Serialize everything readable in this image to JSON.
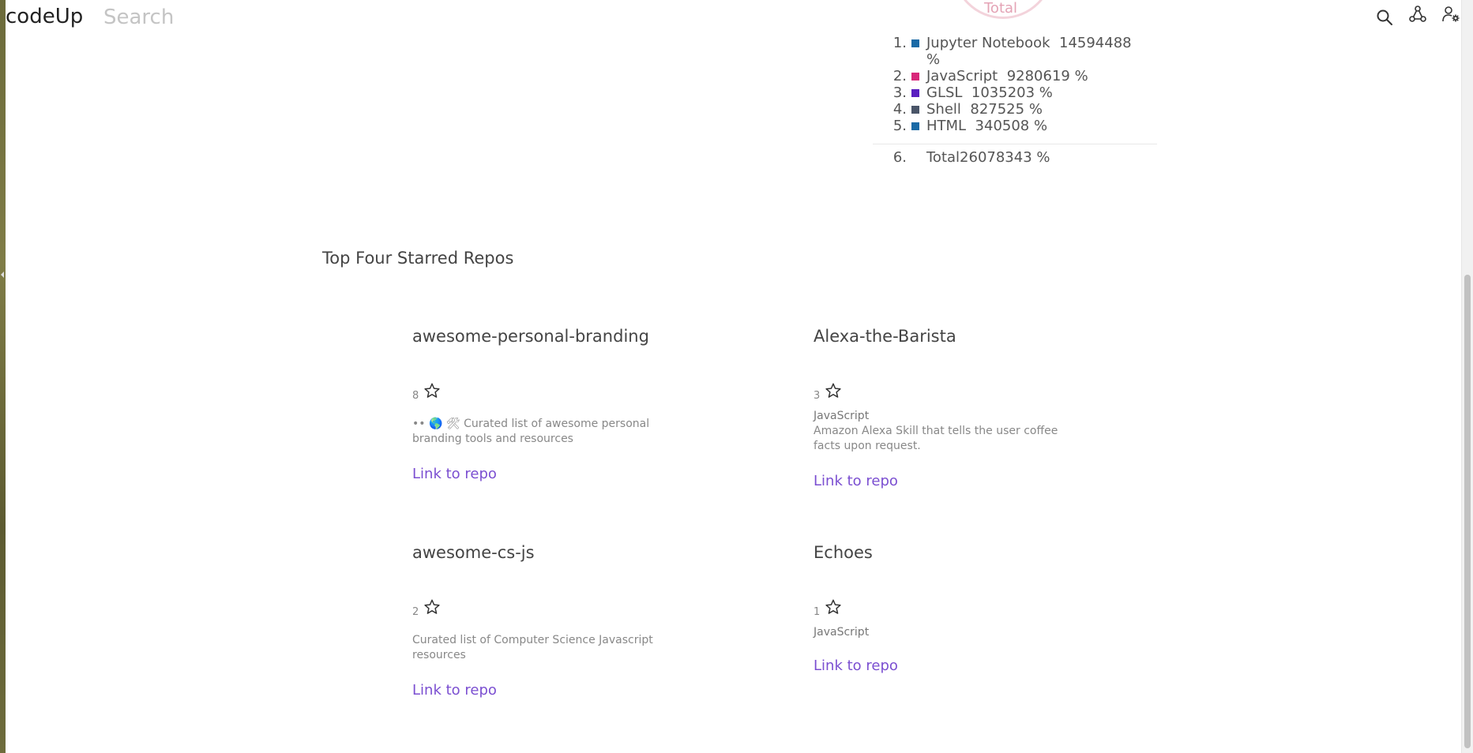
{
  "header": {
    "logo": "codeUp",
    "search_placeholder": "Search",
    "icons": [
      "search-icon",
      "network-icon",
      "user-settings-icon"
    ]
  },
  "languages_chart": {
    "center_label": "Total",
    "items": [
      {
        "num": "1.",
        "name": "Jupyter Notebook",
        "value": "14594488",
        "unit": "%",
        "color": "#1a6aa6"
      },
      {
        "num": "2.",
        "name": "JavaScript",
        "value": "9280619",
        "unit": "%",
        "color": "#d8277a"
      },
      {
        "num": "3.",
        "name": "GLSL",
        "value": "1035203",
        "unit": "%",
        "color": "#5a1fc0"
      },
      {
        "num": "4.",
        "name": "Shell",
        "value": "827525",
        "unit": "%",
        "color": "#4a5568"
      },
      {
        "num": "5.",
        "name": "HTML",
        "value": "340508",
        "unit": "%",
        "color": "#1a6aa6"
      }
    ],
    "total": {
      "num": "6.",
      "label": "Total26078343 %"
    }
  },
  "starred": {
    "title": "Top Four Starred Repos",
    "repos": [
      {
        "name": "awesome-personal-branding",
        "stars": "8",
        "language": "",
        "description": "•• 🌎 🛠 Curated list of awesome personal branding tools and resources",
        "link": "Link to repo"
      },
      {
        "name": "Alexa-the-Barista",
        "stars": "3",
        "language": "JavaScript",
        "description": "Amazon Alexa Skill that tells the user coffee facts upon request.",
        "link": "Link to repo"
      },
      {
        "name": "awesome-cs-js",
        "stars": "2",
        "language": "",
        "description": "Curated list of Computer Science Javascript resources",
        "link": "Link to repo"
      },
      {
        "name": "Echoes",
        "stars": "1",
        "language": "JavaScript",
        "description": "",
        "link": "Link to repo"
      }
    ]
  },
  "colors": {
    "accent_link": "#7b4fd1"
  }
}
